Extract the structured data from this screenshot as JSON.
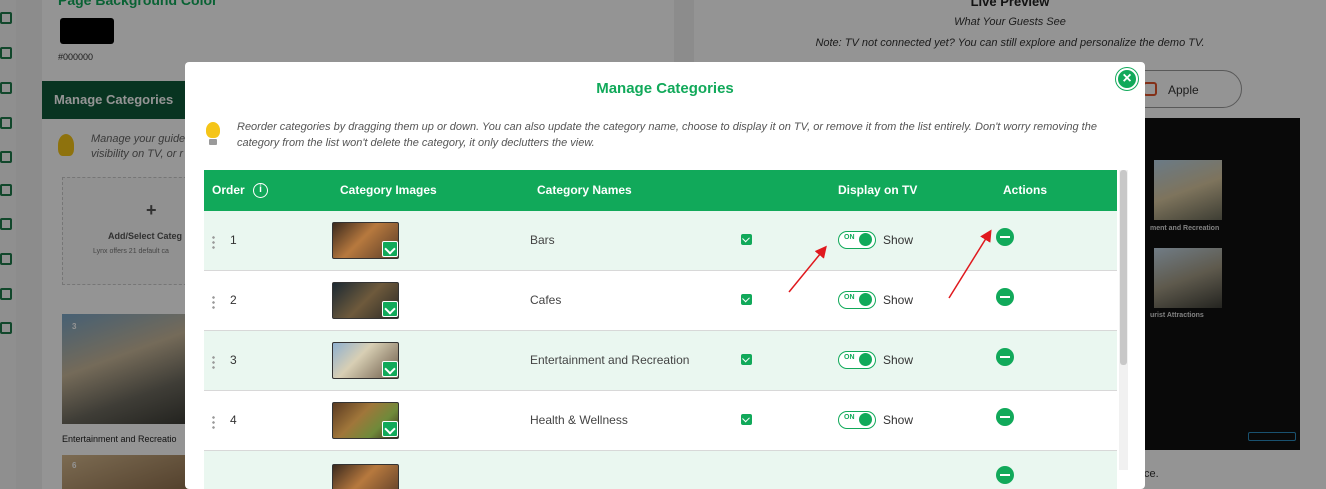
{
  "background": {
    "left_panel": {
      "section_title": "Page Background Color",
      "color_hex": "#000000",
      "manage_categories_label": "Manage Categories",
      "guide_text": "Manage your guide visibility on TV, or r",
      "add_title": "Add/Select Categ",
      "add_sub": "Lynx offers 21 default ca",
      "card3_num": "3",
      "card3_caption": "Entertainment and Recreatio",
      "card6_num": "6"
    },
    "right_panel": {
      "title": "Live Preview",
      "subtitle": "What Your Guests See",
      "note": "Note: TV not connected yet? You can still explore and personalize the demo TV.",
      "apple_label": "Apple",
      "tv_caption1": "ment and Recreation",
      "tv_caption2": "urist Attractions",
      "footer_frag": "ce."
    }
  },
  "modal": {
    "title": "Manage Categories",
    "instructions": "Reorder categories by dragging them up or down. You can also update the category name, choose to display it on TV, or remove it from the list entirely. Don't worry removing the category from the list won't delete the category, it only declutters the view.",
    "columns": {
      "order": "Order",
      "images": "Category Images",
      "names": "Category Names",
      "display": "Display on TV",
      "actions": "Actions"
    },
    "toggle_on_label": "ON",
    "show_label": "Show",
    "rows": [
      {
        "order": "1",
        "name": "Bars"
      },
      {
        "order": "2",
        "name": "Cafes"
      },
      {
        "order": "3",
        "name": "Entertainment and Recreation"
      },
      {
        "order": "4",
        "name": "Health & Wellness"
      }
    ]
  },
  "colors": {
    "accent": "#11a95a",
    "annotation_arrow": "#e0191e"
  }
}
